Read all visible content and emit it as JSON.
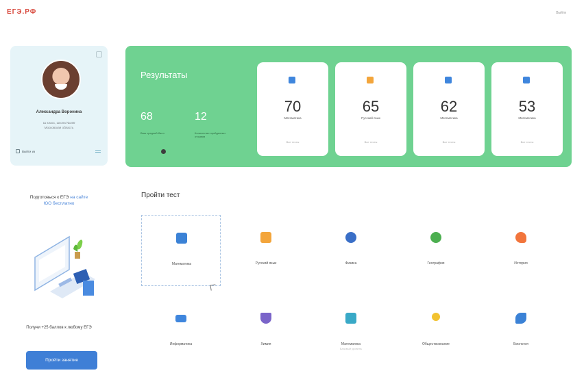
{
  "header": {
    "logo": "ЕГЭ.РФ",
    "exit_label": "Выйти"
  },
  "profile": {
    "name": "Александра Воронина",
    "line1": "11 класс, школа №150",
    "line2": "Московская область",
    "logout_label": "Выйти из"
  },
  "results": {
    "title": "Результаты",
    "stats": [
      {
        "value": "68",
        "label": "Ваш средний балл"
      },
      {
        "value": "12",
        "label": "Количество пройденных отзывов"
      }
    ],
    "scores": [
      {
        "value": "70",
        "subject": "Математика",
        "footer": "Все тесты",
        "color": "#3f86dd"
      },
      {
        "value": "65",
        "subject": "Русский язык",
        "footer": "Все тесты",
        "color": "#f3a53b"
      },
      {
        "value": "62",
        "subject": "Математика",
        "footer": "Все тесты",
        "color": "#3f86dd"
      },
      {
        "value": "53",
        "subject": "Математика",
        "footer": "Все тесты",
        "color": "#3f86dd"
      }
    ]
  },
  "promo": {
    "title_prefix": "Подготовься к ЕГЭ ",
    "title_highlight": "на сайте",
    "title_suffix": "ЮО бесплатно",
    "text": "Получи +25 баллов к любому ЕГЭ",
    "button_label": "Пройти занятие"
  },
  "tests": {
    "title": "Пройти тест",
    "items": [
      {
        "label": "Математика",
        "icon": "folder-icon",
        "color": "#3b82d6",
        "hint": ""
      },
      {
        "label": "Русский язык",
        "icon": "document-icon",
        "color": "#f3a53b",
        "hint": ""
      },
      {
        "label": "Физика",
        "icon": "planet-icon",
        "color": "#3a6fc7",
        "hint": ""
      },
      {
        "label": "География",
        "icon": "globe-icon",
        "color": "#4caf50",
        "hint": ""
      },
      {
        "label": "История",
        "icon": "history-icon",
        "color": "#f2753c",
        "hint": ""
      },
      {
        "label": "Информатика",
        "icon": "computer-icon",
        "color": "#3f86dd",
        "hint": ""
      },
      {
        "label": "Химия",
        "icon": "flask-icon",
        "color": "#7a64c9",
        "hint": ""
      },
      {
        "label": "Математика",
        "icon": "calculator-icon",
        "color": "#39a9c7",
        "hint": "Базовый уровень"
      },
      {
        "label": "Обществознание",
        "icon": "magnifier-icon",
        "color": "#f2c230",
        "hint": ""
      },
      {
        "label": "Биология",
        "icon": "leaf-icon",
        "color": "#3b82d6",
        "hint": ""
      }
    ]
  },
  "colors": {
    "results_bg": "#6fd291",
    "profile_bg": "#e6f4f8",
    "accent": "#3f7fd6",
    "logo": "#d8483c"
  }
}
